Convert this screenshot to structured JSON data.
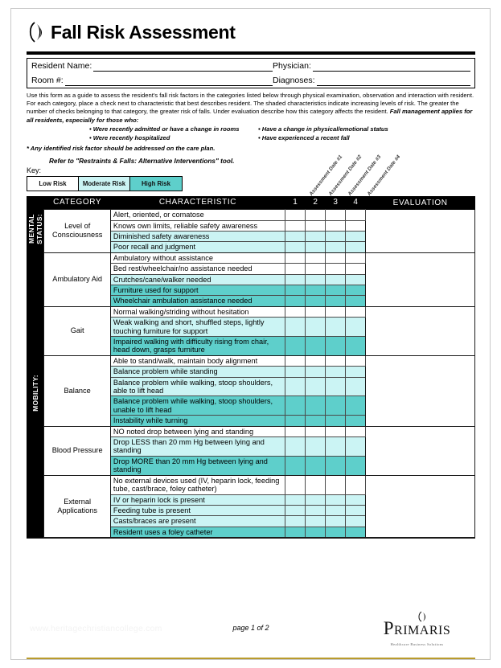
{
  "document": {
    "title": "Fall Risk Assessment",
    "page_number": "page 1 of 2",
    "watermark": "www.heritagechristiancollege.com"
  },
  "patient_fields": {
    "resident_name_label": "Resident Name:",
    "physician_label": "Physician:",
    "room_label": "Room #:",
    "diagnoses_label": "Diagnoses:"
  },
  "instructions": {
    "paragraph": "Use this form as a guide to assess the resident's fall risk factors in the categories listed below through physical examination, observation and interaction with resident. For each category, place a check next to characteristic that best describes resident. The shaded characteristics indicate increasing levels of risk. The greater the number of checks belonging to that category, the greater  risk of falls. Under evaluation describe how this category affects the resident. ",
    "emphasis": "Fall management applies for all residents, especially for those who:",
    "bullets_left": [
      "• Were recently admitted or have a change in rooms",
      "• Were recently hospitalized"
    ],
    "bullets_right": [
      "• Have a change in physical/emotional status",
      "• Have experienced a recent fall"
    ],
    "note": "* Any identified risk factor should be addressed on the care plan.",
    "refer": "Refer to \"Restraints & Falls: Alternative Interventions\" tool."
  },
  "key": {
    "label": "Key:",
    "items": [
      {
        "label": "Low Risk",
        "color": "#ffffff",
        "level": "low"
      },
      {
        "label": "Moderate Risk",
        "color": "#cbf4f4",
        "level": "mod"
      },
      {
        "label": "High Risk",
        "color": "#5ecfcb",
        "level": "high"
      }
    ]
  },
  "assessment_date_headers": [
    "Assessment Date #1",
    "Assessment Date #2",
    "Assessment Date #3",
    "Assessment Date #4"
  ],
  "table": {
    "headers": {
      "category": "CATEGORY",
      "characteristic": "CHARACTERISTIC",
      "num1": "1",
      "num2": "2",
      "num3": "3",
      "num4": "4",
      "evaluation": "EVALUATION"
    },
    "sections": [
      {
        "side_label": "MENTAL\nSTATUS:",
        "groups": [
          {
            "category": "Level of\nConsciousness",
            "rows": [
              {
                "text": "Alert, oriented, or comatose",
                "risk": "low"
              },
              {
                "text": "Knows own limits, reliable safety awareness",
                "risk": "low"
              },
              {
                "text": "Diminished safety awareness",
                "risk": "mod"
              },
              {
                "text": "Poor recall and judgment",
                "risk": "mod"
              }
            ]
          }
        ]
      },
      {
        "side_label": "MOBILITY:",
        "groups": [
          {
            "category": "Ambulatory Aid",
            "rows": [
              {
                "text": "Ambulatory without assistance",
                "risk": "low"
              },
              {
                "text": "Bed rest/wheelchair/no assistance needed",
                "risk": "low"
              },
              {
                "text": "Crutches/cane/walker needed",
                "risk": "mod"
              },
              {
                "text": "Furniture used for support",
                "risk": "high"
              },
              {
                "text": "Wheelchair ambulation assistance needed",
                "risk": "high"
              }
            ]
          },
          {
            "category": "Gait",
            "rows": [
              {
                "text": "Normal walking/striding without hesitation",
                "risk": "low"
              },
              {
                "text": "Weak walking and short, shuffled steps, lightly touching furniture for support",
                "risk": "mod"
              },
              {
                "text": "Impaired walking with difficulty rising from chair, head down, grasps furniture",
                "risk": "high"
              }
            ]
          },
          {
            "category": "Balance",
            "rows": [
              {
                "text": "Able to stand/walk, maintain body alignment",
                "risk": "low"
              },
              {
                "text": "Balance problem while standing",
                "risk": "mod"
              },
              {
                "text": "Balance problem while walking, stoop shoulders, able to lift head",
                "risk": "mod"
              },
              {
                "text": "Balance problem while walking, stoop shoulders, unable to lift head",
                "risk": "high"
              },
              {
                "text": "Instability while turning",
                "risk": "high"
              }
            ]
          },
          {
            "category": "Blood Pressure",
            "rows": [
              {
                "text": "NO noted drop between lying and standing",
                "risk": "low"
              },
              {
                "text": "Drop LESS than 20 mm Hg between lying and standing",
                "risk": "mod"
              },
              {
                "text": "Drop MORE than 20 mm Hg between lying and standing",
                "risk": "high"
              }
            ]
          },
          {
            "category": "External\nApplications",
            "rows": [
              {
                "text": "No external devices used (IV, heparin lock, feeding tube, cast/brace, foley catheter)",
                "risk": "low"
              },
              {
                "text": "IV or heparin lock is present",
                "risk": "mod"
              },
              {
                "text": "Feeding tube is present",
                "risk": "mod"
              },
              {
                "text": "Casts/braces are present",
                "risk": "mod"
              },
              {
                "text": "Resident uses a foley catheter",
                "risk": "high"
              }
            ]
          }
        ]
      }
    ]
  },
  "brand": {
    "name_first": "P",
    "name_rest": "RIMARIS",
    "tagline": "Healthcare Business Solutions"
  }
}
